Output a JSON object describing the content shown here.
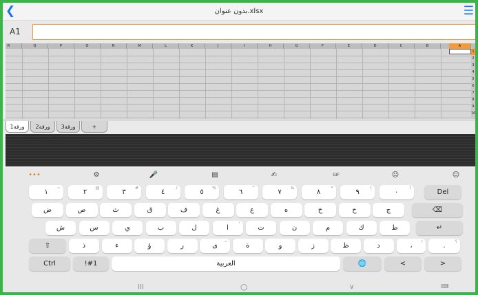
{
  "titlebar": {
    "back_icon": "chevron-left-icon",
    "title": "بدون عنوان.xlsx",
    "menu_icon": "menu-icon"
  },
  "formula_bar": {
    "cell_ref": "A1",
    "value": ""
  },
  "sheet": {
    "columns": [
      "R",
      "Q",
      "P",
      "O",
      "N",
      "M",
      "L",
      "K",
      "J",
      "I",
      "H",
      "G",
      "F",
      "E",
      "D",
      "C",
      "B",
      "A"
    ],
    "rows": [
      "1",
      "2",
      "3",
      "4",
      "5",
      "6",
      "7",
      "8",
      "9",
      "10"
    ]
  },
  "tabs": {
    "items": [
      "ورقة1",
      "ورقة2",
      "ورقة3"
    ],
    "add_label": "+"
  },
  "toolbar": {
    "items": [
      "•••",
      "⚙",
      "🎤",
      "▤",
      "✍",
      "GIF",
      "☺",
      "☺"
    ]
  },
  "keyboard": {
    "row1": [
      [
        "١",
        "~"
      ],
      [
        "٢",
        "@"
      ],
      [
        "٣",
        "#"
      ],
      [
        "٤",
        "/"
      ],
      [
        "٥",
        "%"
      ],
      [
        "٦",
        "^"
      ],
      [
        "٧",
        "&"
      ],
      [
        "٨",
        "*"
      ],
      [
        "٩",
        "("
      ],
      [
        "٠",
        ")"
      ]
    ],
    "del": "Del",
    "row2": [
      "ض",
      "ص",
      "ث",
      "ق",
      "ف",
      "غ",
      "ع",
      "ه",
      "خ",
      "ح",
      "ج"
    ],
    "backspace_icon": "⌫",
    "row3": [
      "ش",
      "س",
      "ي",
      "ب",
      "ل",
      "ا",
      "ت",
      "ن",
      "م",
      "ك",
      "ط"
    ],
    "row3_sup": {
      "5": "'"
    },
    "enter_icon": "↵",
    "shift_icon": "⇧",
    "row4": [
      "ذ",
      "ء",
      "ؤ",
      "ر",
      "ى",
      "ة",
      "و",
      "ز",
      "ظ",
      "د"
    ],
    "row4_sup": {
      "4": "~"
    },
    "comma_key": [
      "،",
      "!"
    ],
    "dot_key": [
      ".",
      "؟"
    ],
    "ctrl": "Ctrl",
    "sym": "!#1",
    "space": "العربية",
    "globe_icon": "🌐",
    "left_icon": "<",
    "right_icon": ">"
  },
  "navbar": {
    "recent": "III",
    "home": "○",
    "back": "∨",
    "keyboard_icon": "⌨"
  }
}
